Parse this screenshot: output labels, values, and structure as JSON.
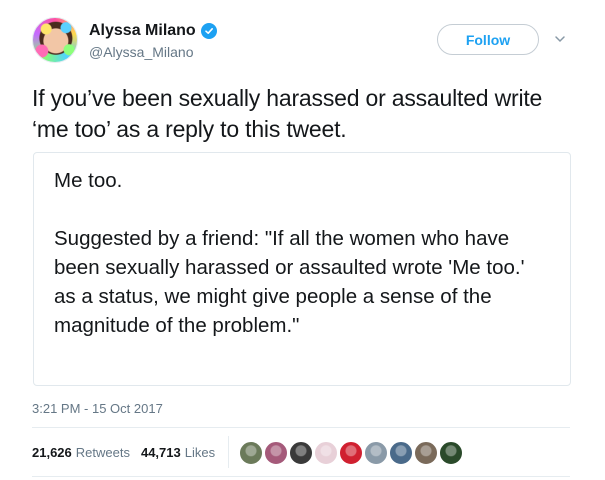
{
  "user": {
    "name": "Alyssa Milano",
    "handle": "@Alyssa_Milano",
    "verified": true,
    "verified_icon": "verified-badge-icon",
    "avatar_icon": "avatar-image"
  },
  "actions": {
    "follow_label": "Follow",
    "more_icon": "chevron-down-icon"
  },
  "tweet": {
    "text": "If you’ve been sexually harassed or assaulted write ‘me too’ as a reply to this tweet."
  },
  "quote_card": {
    "line1": "Me too.",
    "body": "Suggested by a friend: \"If all the women who have been sexually harassed or assaulted wrote 'Me too.' as a status, we might give people a sense of the magnitude of the problem.\""
  },
  "meta": {
    "timestamp": "3:21 PM - 15 Oct 2017"
  },
  "stats": {
    "retweets_count": "21,626",
    "retweets_label": "Retweets",
    "likes_count": "44,713",
    "likes_label": "Likes"
  },
  "likers": [
    {
      "color": "#6b7a5a"
    },
    {
      "color": "#a55a7a"
    },
    {
      "color": "#3a3a3a"
    },
    {
      "color": "#e8d0d8"
    },
    {
      "color": "#d02030"
    },
    {
      "color": "#8a9aa8"
    },
    {
      "color": "#4a6a8a"
    },
    {
      "color": "#7a6a5a"
    },
    {
      "color": "#2a4a2a"
    }
  ],
  "colors": {
    "accent": "#1da1f2",
    "text_primary": "#14171a",
    "text_secondary": "#657786",
    "border": "#e1e8ed"
  }
}
